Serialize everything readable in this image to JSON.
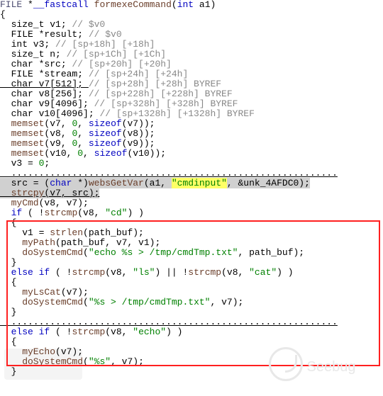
{
  "file_watermark": "Seebug",
  "code": {
    "sig_1a": "FILE",
    "sig_1b": " *",
    "sig_1c": "__fastcall",
    "sig_1d": " ",
    "sig_1e": "formexeCommand",
    "sig_1f": "(",
    "sig_1g": "int",
    "sig_1h": " a1)",
    "brace_open": "{",
    "d1a": "  size_t v1; ",
    "d1b": "// $v0",
    "d2a": "  FILE *result; ",
    "d2b": "// $v0",
    "d3a": "  int v3; ",
    "d3b": "// [sp+18h] [+18h]",
    "d4a": "  size_t n; ",
    "d4b": "// [sp+1Ch] [+1Ch]",
    "d5a": "  char *src; ",
    "d5b": "// [sp+20h] [+20h]",
    "d6a": "  FILE *stream; ",
    "d6b": "// [sp+24h] [+24h]",
    "d7a": "  char v7[512]; ",
    "d7b": "// [sp+28h] [+28h] BYREF",
    "d8a": "  char v8[256]; ",
    "d8b": "// [sp+228h] [+228h] BYREF",
    "d9a": "  char v9[4096]; ",
    "d9b": "// [sp+328h] [+328h] BYREF",
    "d10a": "  char v10[4096]; ",
    "d10b": "// [sp+1328h] [+1328h] BYREF",
    "blank": "",
    "m1a": "  memset",
    "m1b": "(v7, ",
    "m_zero": "0",
    "m_sizeof": "sizeof",
    "m1c": "(v7));",
    "m2c": "(v8));",
    "m3c": "(v9));",
    "m4c": "(v10));",
    "m2a": "(v8, ",
    "m3a": "(v9, ",
    "m4a": "(v10, ",
    "v3line": "  v3 = ",
    "v3end": ";",
    "dots": "  ...........................................................",
    "src1": "  src = (",
    "src2": "char",
    "src3": " *)",
    "src4": "websGetVar",
    "src5": "(a1, ",
    "src6": "\"cmdinput\"",
    "src7": ", &unk_4AFDC0);",
    "strcpy_a": "  strcpy",
    "strcpy_b": "(v7, src);",
    "mycmd_a": "  myCmd",
    "mycmd_b": "(v8, v7);",
    "if1a": "  if",
    "if1b": " ( !",
    "if1c": "strcmp",
    "if1d": "(v8, ",
    "if1e": "\"cd\"",
    "if1f": ") )",
    "opb": "  {",
    "v1line_a": "    v1 = ",
    "v1line_b": "strlen",
    "v1line_c": "(path_buf);",
    "mypath_a": "    myPath",
    "mypath_b": "(path_buf, v7, v1);",
    "dosys1_a": "    doSystemCmd",
    "dosys1_b": "(",
    "dosys1_c": "\"echo %s > /tmp/cmdTmp.txt\"",
    "dosys1_d": ", path_buf);",
    "clb": "  }",
    "elif_a": "  else if",
    "elif_b": " ( !",
    "elif_c": "strcmp",
    "elif_d": "(v8, ",
    "elif_e": "\"ls\"",
    "elif_f": ") || !",
    "elif_g": "strcmp",
    "elif_h": "(v8, ",
    "elif_i": "\"cat\"",
    "elif_j": ") )",
    "mylscat_a": "    myLsCat",
    "mylscat_b": "(v7);",
    "dosys2_a": "    doSystemCmd",
    "dosys2_b": "(",
    "dosys2_c": "\"%s > /tmp/cmdTmp.txt\"",
    "dosys2_d": ", v7);",
    "dots2": "  ...........................................................",
    "elif2_a": "  else if",
    "elif2_b": " ( !",
    "elif2_c": "strcmp",
    "elif2_d": "(v8, ",
    "elif2_e": "\"echo\"",
    "elif2_f": ") )",
    "myecho_a": "    myEcho",
    "myecho_b": "(v7);",
    "dosys3_a": "    doSystemCmd",
    "dosys3_b": "(",
    "dosys3_c": "\"%s\"",
    "dosys3_d": ", v7);"
  }
}
